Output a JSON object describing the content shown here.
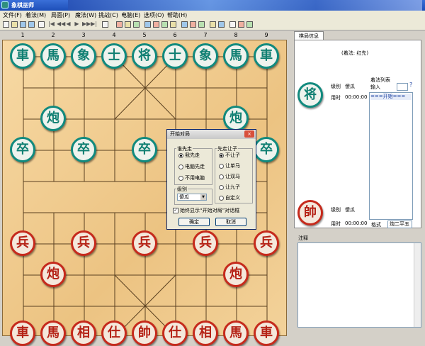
{
  "window": {
    "title": "象棋巫师"
  },
  "menu": [
    "文件(F)",
    "着法(M)",
    "局面(P)",
    "魔法(W)",
    "挑战(C)",
    "电脑(E)",
    "选项(O)",
    "帮助(H)"
  ],
  "ruler": [
    "1",
    "2",
    "3",
    "4",
    "5",
    "6",
    "7",
    "8",
    "9"
  ],
  "board": {
    "black_back": [
      "車",
      "馬",
      "象",
      "士",
      "将",
      "士",
      "象",
      "馬",
      "車"
    ],
    "black_cannon": "炮",
    "black_pawn": "卒",
    "red_pawn": "兵",
    "red_cannon": "炮",
    "red_back": [
      "車",
      "馬",
      "相",
      "仕",
      "帥",
      "仕",
      "相",
      "馬",
      "車"
    ]
  },
  "panel": {
    "tab_label": "棋局信息",
    "side_info": "(着法: 红先)",
    "top_piece": "将",
    "top_level_label": "级别",
    "top_level_value": "傻瓜",
    "top_time_label": "用时",
    "top_time_value": "00:00:00",
    "bottom_piece": "帥",
    "bottom_level_label": "级别",
    "bottom_level_value": "傻瓜",
    "bottom_time_label": "用时",
    "bottom_time_value": "00:00:00",
    "moves_title": "着法列表",
    "input_label": "输入",
    "moves": [
      "===开始==="
    ],
    "format_label": "格式",
    "format_value": "炮二平五",
    "comment_label": "注释"
  },
  "dialog": {
    "title": "开始对局",
    "close": "×",
    "first_group": "谁先走",
    "first_options": [
      "我先走",
      "电脑先走",
      "不用电脑"
    ],
    "first_selected": 0,
    "handicap_group": "先走让子",
    "handicap_options": [
      "不让子",
      "让单马",
      "让双马",
      "让九子",
      "自定义"
    ],
    "handicap_selected": 0,
    "level_group": "级别",
    "level_value": "傻瓜",
    "always_show": "始终显示“开始对局”对话框",
    "always_checked": true,
    "ok_label": "确定",
    "cancel_label": "取消"
  },
  "colors": {
    "black_piece": "#118a7e",
    "red_piece": "#c62a1c",
    "board": "#ecc382"
  }
}
